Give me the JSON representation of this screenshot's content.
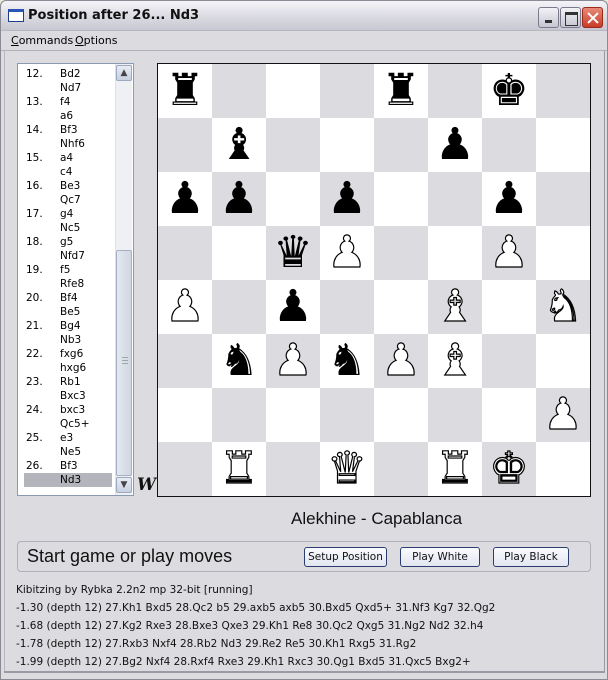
{
  "window": {
    "title": "Position after 26... Nd3",
    "app_icon": "window-icon",
    "controls": [
      "minimize",
      "maximize",
      "close"
    ]
  },
  "menu": {
    "commands": {
      "accel": "C",
      "rest": "ommands"
    },
    "options": {
      "accel": "O",
      "rest": "ptions"
    }
  },
  "moves": [
    {
      "num": "12.",
      "move": "Bd2"
    },
    {
      "num": "",
      "move": "Nd7"
    },
    {
      "num": "13.",
      "move": "f4"
    },
    {
      "num": "",
      "move": "a6"
    },
    {
      "num": "14.",
      "move": "Bf3"
    },
    {
      "num": "",
      "move": "Nhf6"
    },
    {
      "num": "15.",
      "move": "a4"
    },
    {
      "num": "",
      "move": "c4"
    },
    {
      "num": "16.",
      "move": "Be3"
    },
    {
      "num": "",
      "move": "Qc7"
    },
    {
      "num": "17.",
      "move": "g4"
    },
    {
      "num": "",
      "move": "Nc5"
    },
    {
      "num": "18.",
      "move": "g5"
    },
    {
      "num": "",
      "move": "Nfd7"
    },
    {
      "num": "19.",
      "move": "f5"
    },
    {
      "num": "",
      "move": "Rfe8"
    },
    {
      "num": "20.",
      "move": "Bf4"
    },
    {
      "num": "",
      "move": "Be5"
    },
    {
      "num": "21.",
      "move": "Bg4"
    },
    {
      "num": "",
      "move": "Nb3"
    },
    {
      "num": "22.",
      "move": "fxg6"
    },
    {
      "num": "",
      "move": "hxg6"
    },
    {
      "num": "23.",
      "move": "Rb1"
    },
    {
      "num": "",
      "move": "Bxc3"
    },
    {
      "num": "24.",
      "move": "bxc3"
    },
    {
      "num": "",
      "move": "Qc5+"
    },
    {
      "num": "25.",
      "move": "e3"
    },
    {
      "num": "",
      "move": "Ne5"
    },
    {
      "num": "26.",
      "move": "Bf3"
    },
    {
      "num": "",
      "move": "Nd3",
      "selected": true
    }
  ],
  "side_to_move_label": "W",
  "board": {
    "orientation": "white-bottom",
    "colors": {
      "light": "#ffffff",
      "dark": "#dcdce0"
    },
    "pieces": [
      {
        "square": "a8",
        "color": "black",
        "type": "rook",
        "glyph": "♜"
      },
      {
        "square": "e8",
        "color": "black",
        "type": "rook",
        "glyph": "♜"
      },
      {
        "square": "g8",
        "color": "black",
        "type": "king",
        "glyph": "♚"
      },
      {
        "square": "b7",
        "color": "black",
        "type": "bishop",
        "glyph": "♝"
      },
      {
        "square": "f7",
        "color": "black",
        "type": "pawn",
        "glyph": "♟"
      },
      {
        "square": "a6",
        "color": "black",
        "type": "pawn",
        "glyph": "♟"
      },
      {
        "square": "b6",
        "color": "black",
        "type": "pawn",
        "glyph": "♟"
      },
      {
        "square": "d6",
        "color": "black",
        "type": "pawn",
        "glyph": "♟"
      },
      {
        "square": "g6",
        "color": "black",
        "type": "pawn",
        "glyph": "♟"
      },
      {
        "square": "c5",
        "color": "black",
        "type": "queen",
        "glyph": "♛"
      },
      {
        "square": "d5",
        "color": "white",
        "type": "pawn",
        "glyph": "♟"
      },
      {
        "square": "g5",
        "color": "white",
        "type": "pawn",
        "glyph": "♟"
      },
      {
        "square": "a4",
        "color": "white",
        "type": "pawn",
        "glyph": "♟"
      },
      {
        "square": "c4",
        "color": "black",
        "type": "pawn",
        "glyph": "♟"
      },
      {
        "square": "f4",
        "color": "white",
        "type": "bishop",
        "glyph": "♝"
      },
      {
        "square": "h4",
        "color": "white",
        "type": "knight",
        "glyph": "♞"
      },
      {
        "square": "b3",
        "color": "black",
        "type": "knight",
        "glyph": "♞"
      },
      {
        "square": "c3",
        "color": "white",
        "type": "pawn",
        "glyph": "♟"
      },
      {
        "square": "d3",
        "color": "black",
        "type": "knight",
        "glyph": "♞"
      },
      {
        "square": "e3",
        "color": "white",
        "type": "pawn",
        "glyph": "♟"
      },
      {
        "square": "f3",
        "color": "white",
        "type": "bishop",
        "glyph": "♝"
      },
      {
        "square": "h2",
        "color": "white",
        "type": "pawn",
        "glyph": "♟"
      },
      {
        "square": "b1",
        "color": "white",
        "type": "rook",
        "glyph": "♜"
      },
      {
        "square": "d1",
        "color": "white",
        "type": "queen",
        "glyph": "♛"
      },
      {
        "square": "f1",
        "color": "white",
        "type": "rook",
        "glyph": "♜"
      },
      {
        "square": "g1",
        "color": "white",
        "type": "king",
        "glyph": "♚"
      }
    ]
  },
  "players": "Alekhine - Capablanca",
  "status": "Start game or play moves",
  "buttons": {
    "setup": "Setup Position",
    "play_white": "Play White",
    "play_black": "Play Black"
  },
  "kibitz": {
    "header": "Kibitzing by Rybka 2.2n2 mp 32-bit  [running]",
    "lines": [
      "-1.30 (depth 12) 27.Kh1 Bxd5 28.Qc2 b5 29.axb5 axb5 30.Bxd5 Qxd5+ 31.Nf3 Kg7 32.Qg2",
      "-1.68 (depth 12) 27.Kg2 Rxe3 28.Bxe3 Qxe3 29.Kh1 Re8 30.Qc2 Qxg5 31.Ng2 Nd2 32.h4",
      "-1.78 (depth 12) 27.Rxb3 Nxf4 28.Rb2 Nd3 29.Re2 Re5 30.Kh1 Rxg5 31.Rg2",
      "-1.99 (depth 12) 27.Bg2 Nxf4 28.Rxf4 Rxe3 29.Kh1 Rxc3 30.Qg1 Bxd5 31.Qxc5 Bxg2+"
    ]
  }
}
